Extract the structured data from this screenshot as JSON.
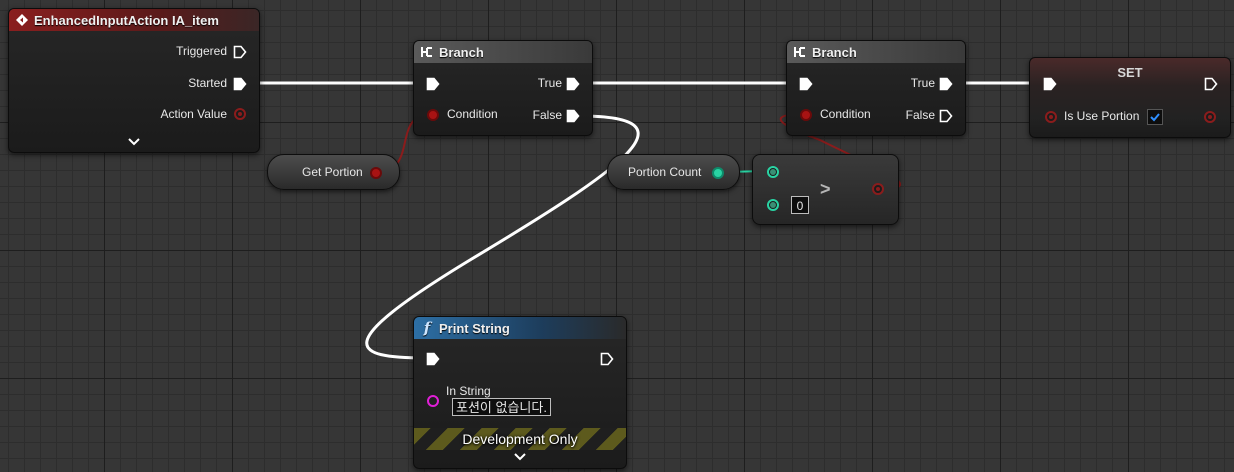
{
  "colors": {
    "exec_wire": "#ffffff",
    "bool_wire": "#8b1c1c",
    "int_wire": "#29d3a3",
    "string_pin": "#e01fd7",
    "event_header": "#8a1f1f",
    "function_header": "#2d6fa5"
  },
  "event_node": {
    "title": "EnhancedInputAction IA_item",
    "pins": [
      "Triggered",
      "Started",
      "Action Value"
    ],
    "icon": "event-diamond-icon"
  },
  "branch1": {
    "title": "Branch",
    "icon": "branch-icon",
    "in_condition": "Condition",
    "out_true": "True",
    "out_false": "False"
  },
  "branch2": {
    "title": "Branch",
    "icon": "branch-icon",
    "in_condition": "Condition",
    "out_true": "True",
    "out_false": "False"
  },
  "get_portion": {
    "label": "Get Portion"
  },
  "portion_count": {
    "label": "Portion Count"
  },
  "compare": {
    "operator": ">",
    "b_value": "0"
  },
  "set_node": {
    "title": "SET",
    "var_label": "Is Use Portion",
    "checked": true
  },
  "print_string": {
    "title": "Print String",
    "icon": "function-icon",
    "in_string_label": "In String",
    "in_string_value": "포션이 없습니다.",
    "dev_label": "Development Only"
  }
}
